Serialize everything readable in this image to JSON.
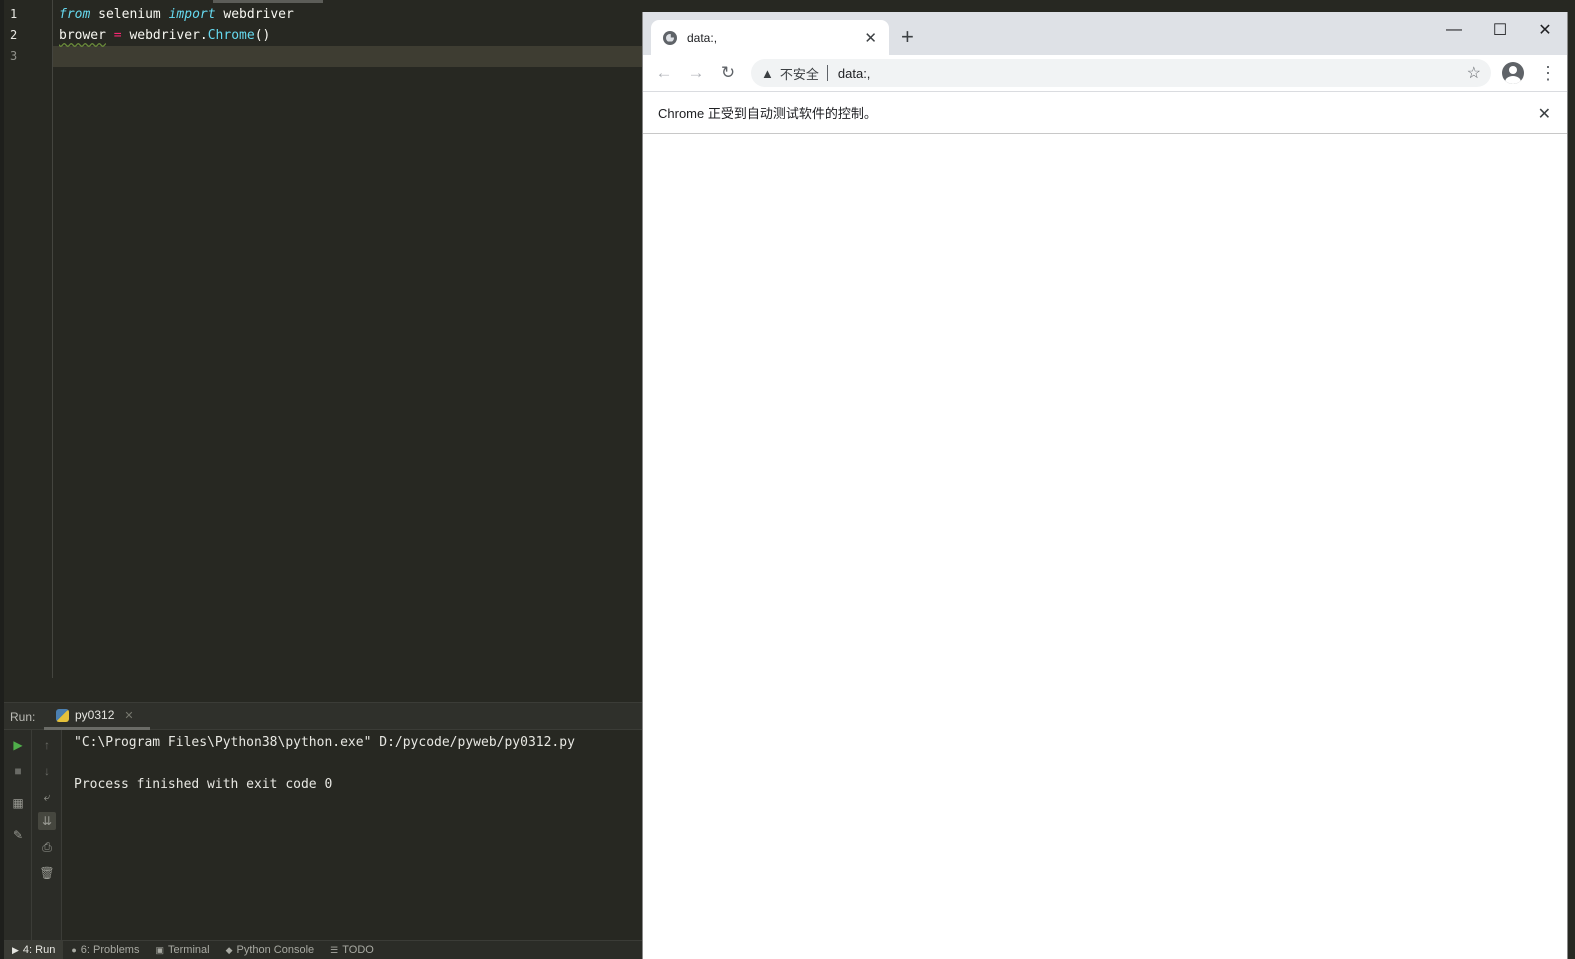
{
  "ide": {
    "line_numbers": [
      "1",
      "2",
      "3"
    ],
    "code": {
      "line1": {
        "kw1": "from",
        "mod": " selenium ",
        "kw2": "import",
        "name": " webdriver"
      },
      "line2": {
        "var": "brower",
        "eq": " = ",
        "obj": "webdriver.",
        "fn": "Chrome",
        "parens": "()"
      }
    },
    "run_panel": {
      "label": "Run:",
      "tab_name": "py0312",
      "console_lines": [
        "\"C:\\Program Files\\Python38\\python.exe\" D:/pycode/pyweb/py0312.py",
        "",
        "Process finished with exit code 0"
      ]
    },
    "bottom_tabs": [
      {
        "label": "4: Run",
        "icon": "play-icon"
      },
      {
        "label": "6: Problems",
        "icon": "info-icon"
      },
      {
        "label": "Terminal",
        "icon": "terminal-icon"
      },
      {
        "label": "Python Console",
        "icon": "python-icon"
      },
      {
        "label": "TODO",
        "icon": "list-icon"
      }
    ],
    "colors": {
      "background": "#272822",
      "keyword": "#66d9ef",
      "operator": "#f92672",
      "current_line": "#3e3d32"
    }
  },
  "browser": {
    "tab_title": "data:,",
    "address_security": "不安全",
    "address_url": "data:,",
    "infobar_text": "Chrome 正受到自动测试软件的控制。",
    "colors": {
      "titlebar": "#dee1e6",
      "omnibox": "#f1f3f4",
      "icon": "#5f6368"
    }
  }
}
